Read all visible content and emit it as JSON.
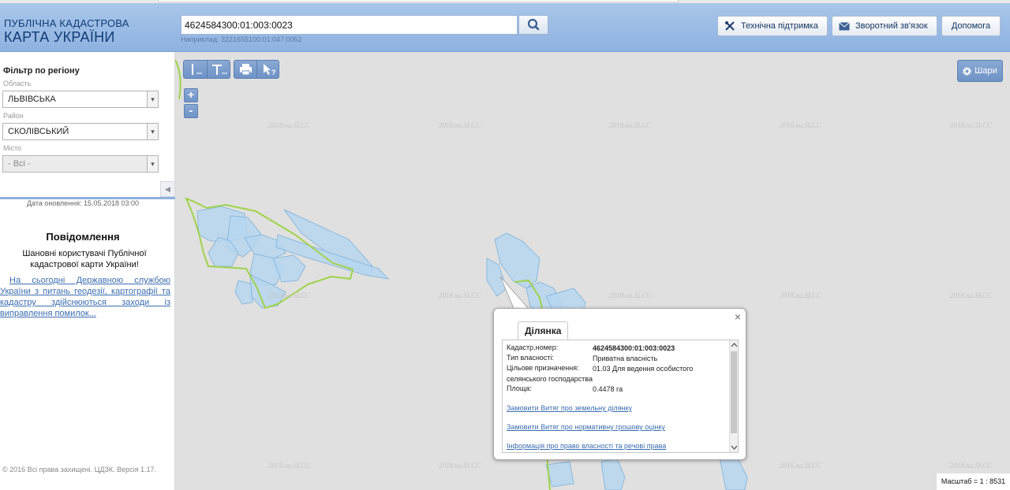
{
  "header": {
    "logo_line1": "ПУБЛІЧНА КАДАСТРОВА",
    "logo_line2": "КАРТА УКРАЇНИ",
    "search_value": "4624584300:01:003:0023",
    "search_hint": "Наприклад: 3221655100:01:047:0052",
    "tech_support_label": "Технічна підтримка",
    "feedback_label": "Зворотний зв'язок",
    "help_label": "Допомога"
  },
  "sidebar": {
    "filter_title": "Фільтр по регіону",
    "region_label": "Область",
    "region_value": "ЛЬВІВСЬКА",
    "district_label": "Район",
    "district_value": "СКОЛІВСЬКИЙ",
    "city_label": "Місто",
    "city_value": "- Всі -",
    "update_date": "Дата оновлення: 15.05.2018 03:00",
    "notice_title": "Повідомлення",
    "notice_text": "Шановні користувачі Публічної кадастрової карти України!",
    "notice_link": "На сьогодні Державною службою України з питань геодезії, картографії та кадастру здійснюються заходи із виправлення помилок...",
    "copyright": "© 2016 Всі права захищені. ЦДЗК. Версія 1.17."
  },
  "map": {
    "layers_label": "Шари",
    "scale_text": "Масштаб = 1 : 8531",
    "watermark": "2018.на.SLCC",
    "parcel_fill": "#b6d6ee",
    "parcel_stroke": "#8cb9dc",
    "boundary_color": "#9fd34a"
  },
  "popup": {
    "tab_label": "Ділянка",
    "cadastral_label": "Кадастр.номер:",
    "cadastral_value": "4624584300:01:003:0023",
    "ownership_label": "Тип власності:",
    "ownership_value": "Приватна власність",
    "purpose_label": "Цільове призначення:",
    "purpose_value": "01.03 Для ведення особистого селянського господарства",
    "area_label": "Площа:",
    "area_value": "0.4478 га",
    "link1": "Замовити Витяг про земельну ділянку",
    "link2": "Замовити Витяг про нормативну грошову оцінку",
    "link3": "Інформація про право власності та речові права"
  }
}
